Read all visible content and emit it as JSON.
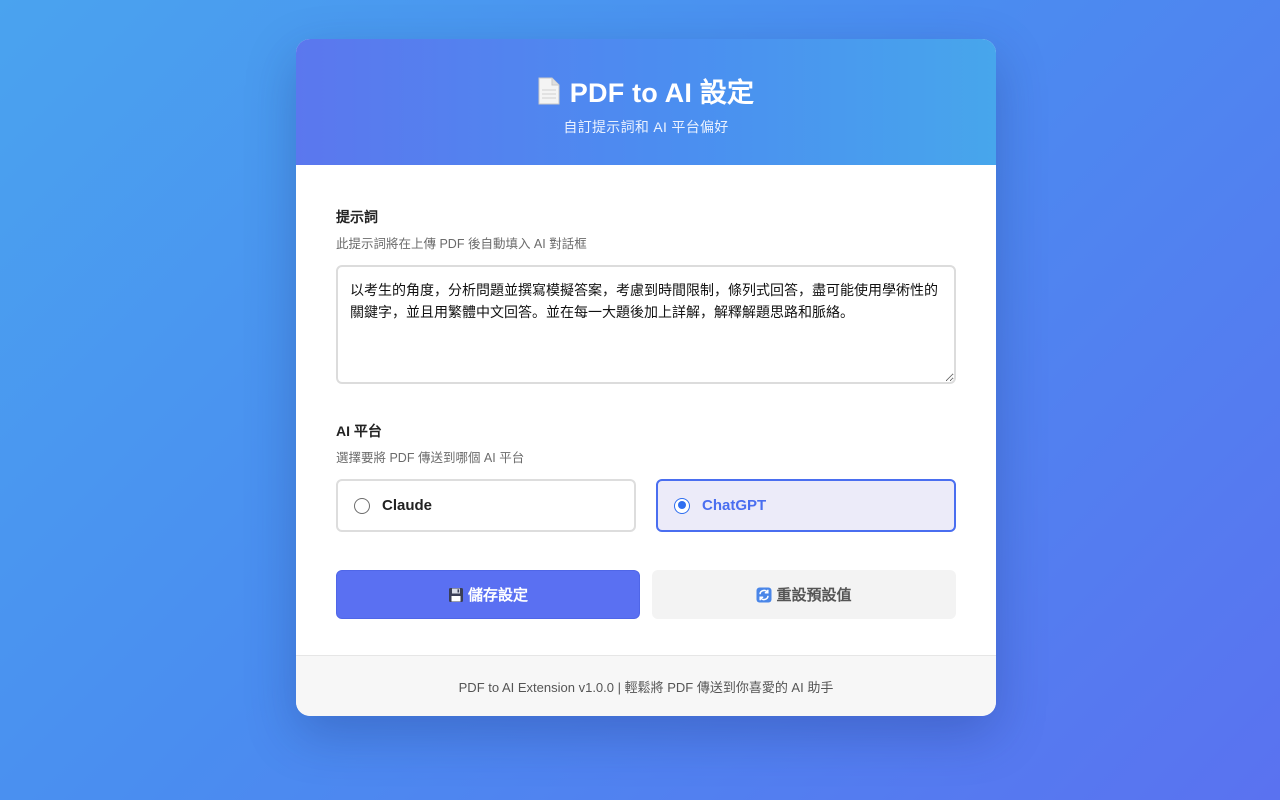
{
  "header": {
    "title": "PDF to AI 設定",
    "subtitle": "自訂提示詞和 AI 平台偏好",
    "icon": "document-icon"
  },
  "prompt": {
    "label": "提示詞",
    "description": "此提示詞將在上傳 PDF 後自動填入 AI 對話框",
    "value": "以考生的角度，分析問題並撰寫模擬答案，考慮到時間限制，條列式回答，盡可能使用學術性的關鍵字，並且用繁體中文回答。並在每一大題後加上詳解，解釋解題思路和脈絡。"
  },
  "platform": {
    "label": "AI 平台",
    "description": "選擇要將 PDF 傳送到哪個 AI 平台",
    "options": [
      {
        "label": "Claude",
        "selected": false
      },
      {
        "label": "ChatGPT",
        "selected": true
      }
    ]
  },
  "buttons": {
    "save_label": "儲存設定",
    "save_icon": "floppy-disk-icon",
    "reset_label": "重設預設值",
    "reset_icon": "refresh-icon"
  },
  "footer": {
    "text": "PDF to AI Extension v1.0.0 | 輕鬆將 PDF 傳送到你喜愛的 AI 助手"
  },
  "colors": {
    "accent": "#5a70f2",
    "selected_border": "#4a6ef0",
    "selected_bg": "#ecebf9"
  }
}
